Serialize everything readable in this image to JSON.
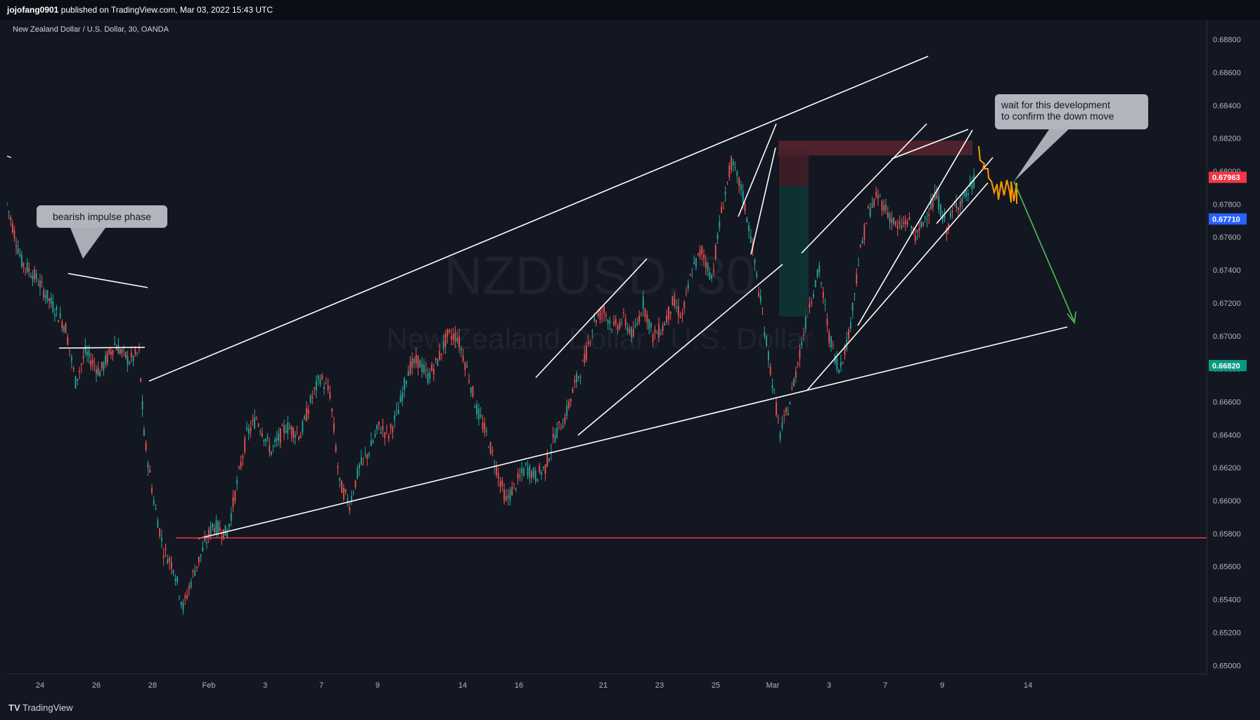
{
  "header": {
    "author": "jojofang0901",
    "published_text": "published on TradingView.com, Mar 03, 2022 15:43 UTC"
  },
  "symbol_title": "New Zealand Dollar / U.S. Dollar, 30, OANDA",
  "watermark": {
    "ticker": "NZDUSD, 30",
    "name": "New Zealand Dollar / U.S. Dollar"
  },
  "colors": {
    "background": "#131722",
    "up": "#26a69a",
    "down": "#ef5350",
    "orange": "#ff9800",
    "green_arrow": "#4caf50",
    "red_line": "#f23645"
  },
  "chart_data": {
    "type": "candlestick",
    "timeframe": "30",
    "x_ticks": [
      "24",
      "26",
      "28",
      "Feb",
      "3",
      "7",
      "9",
      "14",
      "16",
      "21",
      "23",
      "25",
      "Mar",
      "3",
      "7",
      "9",
      "14"
    ],
    "y_ticks": [
      "0.68800",
      "0.68600",
      "0.68400",
      "0.68200",
      "0.68000",
      "0.67800",
      "0.67600",
      "0.67400",
      "0.67200",
      "0.67000",
      "0.66800",
      "0.66600",
      "0.66400",
      "0.66200",
      "0.66000",
      "0.65800",
      "0.65600",
      "0.65400",
      "0.65200",
      "0.65000"
    ],
    "ylim": [
      0.6495,
      0.6892
    ],
    "price_labels": [
      {
        "value": "0.67963",
        "color": "#f23645"
      },
      {
        "value": "0.67710",
        "color": "#2962ff"
      },
      {
        "value": "0.66820",
        "color": "#089981"
      }
    ],
    "close_path": [
      [
        0,
        0.678
      ],
      [
        3,
        0.6745
      ],
      [
        6,
        0.6735
      ],
      [
        9,
        0.672
      ],
      [
        12,
        0.6705
      ],
      [
        14,
        0.6672
      ],
      [
        16,
        0.669
      ],
      [
        19,
        0.6678
      ],
      [
        22,
        0.6695
      ],
      [
        25,
        0.6685
      ],
      [
        27,
        0.669
      ],
      [
        28,
        0.664
      ],
      [
        30,
        0.66
      ],
      [
        32,
        0.657
      ],
      [
        34,
        0.656
      ],
      [
        36,
        0.6535
      ],
      [
        38,
        0.6555
      ],
      [
        40,
        0.657
      ],
      [
        42,
        0.6585
      ],
      [
        45,
        0.658
      ],
      [
        47,
        0.661
      ],
      [
        49,
        0.664
      ],
      [
        51,
        0.665
      ],
      [
        54,
        0.663
      ],
      [
        57,
        0.6645
      ],
      [
        60,
        0.664
      ],
      [
        62,
        0.666
      ],
      [
        64,
        0.6675
      ],
      [
        66,
        0.6665
      ],
      [
        68,
        0.661
      ],
      [
        70,
        0.6598
      ],
      [
        72,
        0.662
      ],
      [
        74,
        0.663
      ],
      [
        76,
        0.6645
      ],
      [
        78,
        0.664
      ],
      [
        80,
        0.6655
      ],
      [
        82,
        0.668
      ],
      [
        84,
        0.6685
      ],
      [
        86,
        0.6675
      ],
      [
        88,
        0.6685
      ],
      [
        90,
        0.67
      ],
      [
        92,
        0.67
      ],
      [
        94,
        0.668
      ],
      [
        96,
        0.6655
      ],
      [
        98,
        0.664
      ],
      [
        100,
        0.662
      ],
      [
        102,
        0.66
      ],
      [
        104,
        0.661
      ],
      [
        106,
        0.662
      ],
      [
        108,
        0.6615
      ],
      [
        110,
        0.662
      ],
      [
        112,
        0.664
      ],
      [
        114,
        0.665
      ],
      [
        116,
        0.667
      ],
      [
        118,
        0.6685
      ],
      [
        120,
        0.671
      ],
      [
        122,
        0.6715
      ],
      [
        124,
        0.6705
      ],
      [
        126,
        0.671
      ],
      [
        128,
        0.67
      ],
      [
        130,
        0.672
      ],
      [
        132,
        0.67
      ],
      [
        134,
        0.6705
      ],
      [
        136,
        0.672
      ],
      [
        138,
        0.6712
      ],
      [
        140,
        0.674
      ],
      [
        142,
        0.6752
      ],
      [
        144,
        0.6735
      ],
      [
        146,
        0.6775
      ],
      [
        148,
        0.6805
      ],
      [
        150,
        0.679
      ],
      [
        152,
        0.676
      ],
      [
        154,
        0.672
      ],
      [
        156,
        0.668
      ],
      [
        158,
        0.664
      ],
      [
        160,
        0.666
      ],
      [
        162,
        0.669
      ],
      [
        164,
        0.672
      ],
      [
        166,
        0.674
      ],
      [
        168,
        0.67
      ],
      [
        170,
        0.668
      ],
      [
        172,
        0.67
      ],
      [
        174,
        0.6745
      ],
      [
        176,
        0.6775
      ],
      [
        178,
        0.6785
      ],
      [
        180,
        0.6775
      ],
      [
        182,
        0.6765
      ],
      [
        184,
        0.677
      ],
      [
        186,
        0.676
      ],
      [
        188,
        0.6775
      ],
      [
        190,
        0.6785
      ],
      [
        192,
        0.6765
      ],
      [
        194,
        0.678
      ],
      [
        196,
        0.6785
      ],
      [
        198,
        0.6796
      ]
    ],
    "annotations": [
      {
        "text": "bearish impulse phase"
      },
      {
        "text": "wait for this development\nto confirm the down move"
      }
    ]
  }
}
